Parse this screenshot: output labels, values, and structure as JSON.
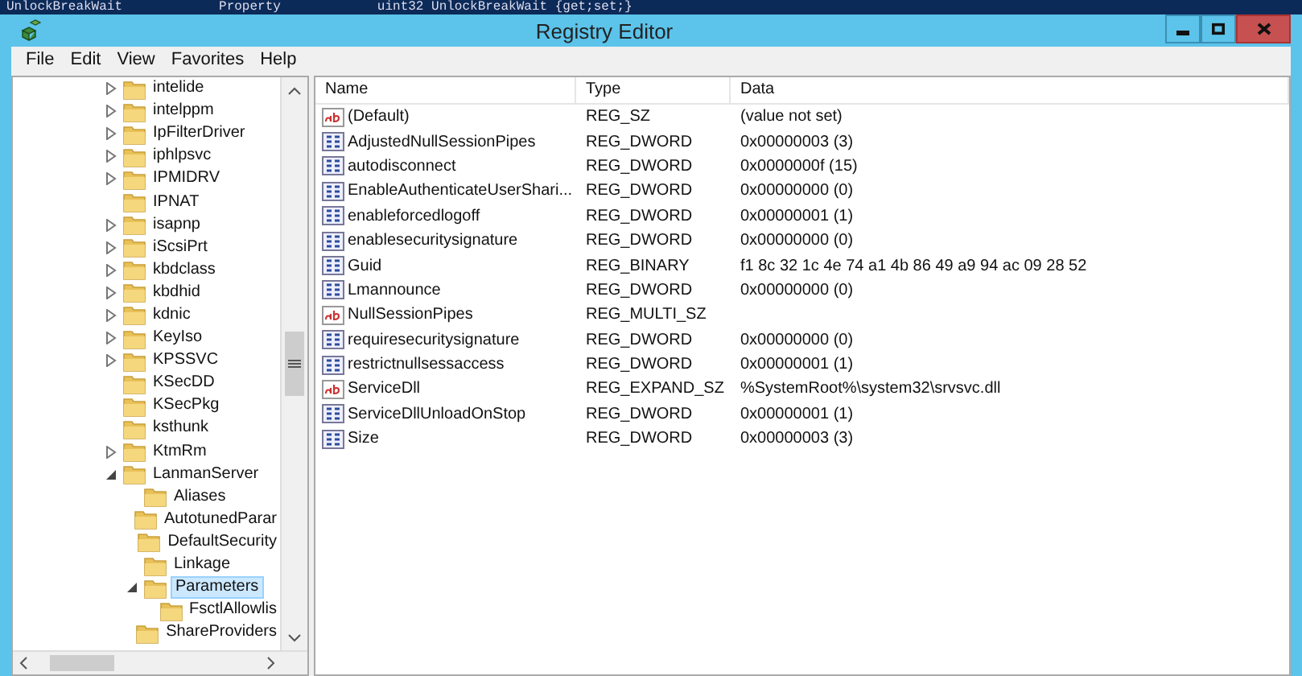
{
  "background_console": {
    "columns": [
      "UnlockBreakWait",
      "Property",
      "uint32 UnlockBreakWait {get;set;}"
    ]
  },
  "window": {
    "title": "Registry Editor"
  },
  "menu": [
    "File",
    "Edit",
    "View",
    "Favorites",
    "Help"
  ],
  "tree": [
    {
      "label": "intelide",
      "expandable": true,
      "expanded": false,
      "selected": false
    },
    {
      "label": "intelppm",
      "expandable": true,
      "expanded": false,
      "selected": false
    },
    {
      "label": "IpFilterDriver",
      "expandable": true,
      "expanded": false,
      "selected": false
    },
    {
      "label": "iphlpsvc",
      "expandable": true,
      "expanded": false,
      "selected": false
    },
    {
      "label": "IPMIDRV",
      "expandable": true,
      "expanded": false,
      "selected": false
    },
    {
      "label": "IPNAT",
      "expandable": false,
      "expanded": false,
      "selected": false
    },
    {
      "label": "isapnp",
      "expandable": true,
      "expanded": false,
      "selected": false
    },
    {
      "label": "iScsiPrt",
      "expandable": true,
      "expanded": false,
      "selected": false
    },
    {
      "label": "kbdclass",
      "expandable": true,
      "expanded": false,
      "selected": false
    },
    {
      "label": "kbdhid",
      "expandable": true,
      "expanded": false,
      "selected": false
    },
    {
      "label": "kdnic",
      "expandable": true,
      "expanded": false,
      "selected": false
    },
    {
      "label": "KeyIso",
      "expandable": true,
      "expanded": false,
      "selected": false
    },
    {
      "label": "KPSSVC",
      "expandable": true,
      "expanded": false,
      "selected": false
    },
    {
      "label": "KSecDD",
      "expandable": false,
      "expanded": false,
      "selected": false
    },
    {
      "label": "KSecPkg",
      "expandable": false,
      "expanded": false,
      "selected": false
    },
    {
      "label": "ksthunk",
      "expandable": false,
      "expanded": false,
      "selected": false
    },
    {
      "label": "KtmRm",
      "expandable": true,
      "expanded": false,
      "selected": false
    },
    {
      "label": "LanmanServer",
      "expandable": true,
      "expanded": true,
      "selected": false,
      "children": [
        {
          "label": "Aliases",
          "expandable": false,
          "expanded": false,
          "selected": false
        },
        {
          "label": "AutotunedParar",
          "expandable": false,
          "expanded": false,
          "selected": false
        },
        {
          "label": "DefaultSecurity",
          "expandable": false,
          "expanded": false,
          "selected": false
        },
        {
          "label": "Linkage",
          "expandable": false,
          "expanded": false,
          "selected": false
        },
        {
          "label": "Parameters",
          "expandable": true,
          "expanded": true,
          "selected": true,
          "children": [
            {
              "label": "FsctlAllowlis",
              "expandable": false,
              "expanded": false,
              "selected": false
            }
          ]
        },
        {
          "label": "ShareProviders",
          "expandable": false,
          "expanded": false,
          "selected": false
        }
      ]
    }
  ],
  "table": {
    "columns": [
      "Name",
      "Type",
      "Data"
    ],
    "rows": [
      {
        "kind": "string",
        "name": "(Default)",
        "type": "REG_SZ",
        "data": "(value not set)"
      },
      {
        "kind": "binary",
        "name": "AdjustedNullSessionPipes",
        "type": "REG_DWORD",
        "data": "0x00000003 (3)"
      },
      {
        "kind": "binary",
        "name": "autodisconnect",
        "type": "REG_DWORD",
        "data": "0x0000000f (15)"
      },
      {
        "kind": "binary",
        "name": "EnableAuthenticateUserShari...",
        "type": "REG_DWORD",
        "data": "0x00000000 (0)"
      },
      {
        "kind": "binary",
        "name": "enableforcedlogoff",
        "type": "REG_DWORD",
        "data": "0x00000001 (1)"
      },
      {
        "kind": "binary",
        "name": "enablesecuritysignature",
        "type": "REG_DWORD",
        "data": "0x00000000 (0)"
      },
      {
        "kind": "binary",
        "name": "Guid",
        "type": "REG_BINARY",
        "data": "f1 8c 32 1c 4e 74 a1 4b 86 49 a9 94 ac 09 28 52"
      },
      {
        "kind": "binary",
        "name": "Lmannounce",
        "type": "REG_DWORD",
        "data": "0x00000000 (0)"
      },
      {
        "kind": "string",
        "name": "NullSessionPipes",
        "type": "REG_MULTI_SZ"
      },
      {
        "kind": "binary",
        "name": "requiresecuritysignature",
        "type": "REG_DWORD",
        "data": "0x00000000 (0)"
      },
      {
        "kind": "binary",
        "name": "restrictnullsessaccess",
        "type": "REG_DWORD",
        "data": "0x00000001 (1)"
      },
      {
        "kind": "string",
        "name": "ServiceDll",
        "type": "REG_EXPAND_SZ",
        "data": "%SystemRoot%\\system32\\srvsvc.dll"
      },
      {
        "kind": "binary",
        "name": "ServiceDllUnloadOnStop",
        "type": "REG_DWORD",
        "data": "0x00000001 (1)"
      },
      {
        "kind": "binary",
        "name": "Size",
        "type": "REG_DWORD",
        "data": "0x00000003 (3)"
      }
    ]
  }
}
